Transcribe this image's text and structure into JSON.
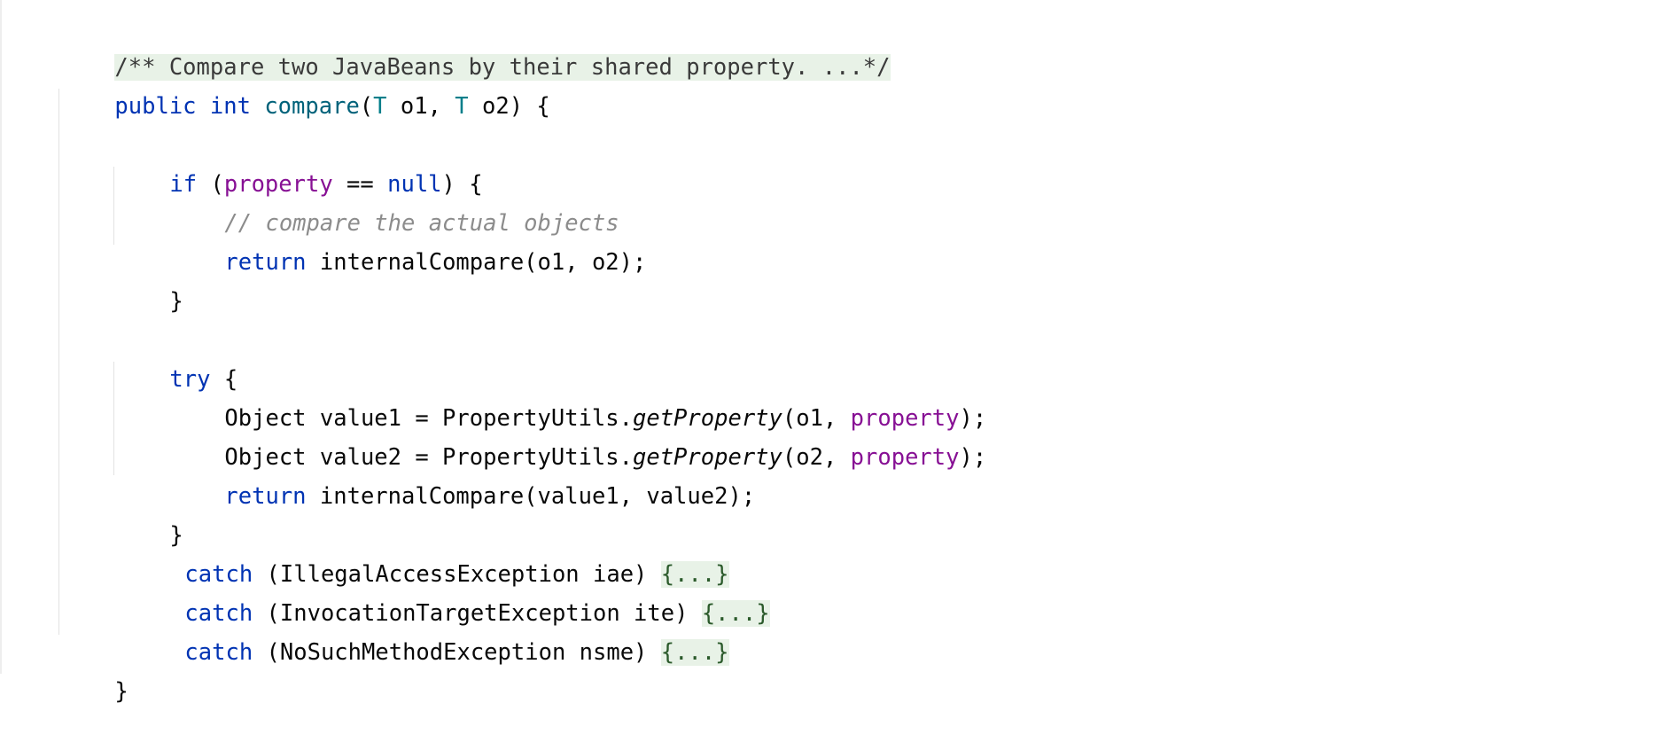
{
  "editor": {
    "doc_fold": "/** Compare two JavaBeans by their shared property. ...*/",
    "sig": {
      "kw_public": "public",
      "kw_int": "int",
      "method": "compare",
      "open_paren": "(",
      "type1": "T",
      "param1": " o1, ",
      "type2": "T",
      "param2": " o2) {"
    },
    "if_line": {
      "kw_if": "if",
      "open": " (",
      "field": "property",
      "op": " == ",
      "kw_null": "null",
      "close": ") {"
    },
    "comment": "// compare the actual objects",
    "return1": {
      "kw": "return",
      "rest": " internalCompare(o1, o2);"
    },
    "close_if": "}",
    "try_line": {
      "kw": "try",
      "rest": " {"
    },
    "value1": {
      "pre": "Object value1 = PropertyUtils.",
      "method": "getProperty",
      "mid": "(o1, ",
      "field": "property",
      "end": ");"
    },
    "value2": {
      "pre": "Object value2 = PropertyUtils.",
      "method": "getProperty",
      "mid": "(o2, ",
      "field": "property",
      "end": ");"
    },
    "return2": {
      "kw": "return",
      "rest": " internalCompare(value1, value2);"
    },
    "close_try": "}",
    "catches": [
      {
        "kw": "catch",
        "rest": " (IllegalAccessException iae) ",
        "fold": "{...}"
      },
      {
        "kw": "catch",
        "rest": " (InvocationTargetException ite) ",
        "fold": "{...}"
      },
      {
        "kw": "catch",
        "rest": " (NoSuchMethodException nsme) ",
        "fold": "{...}"
      }
    ],
    "close_method": "}"
  },
  "colors": {
    "keyword": "#0033b3",
    "method_decl": "#00627a",
    "type_param": "#007e8a",
    "field": "#871094",
    "comment": "#8c8c8c",
    "fold_bg": "#e8f2e7"
  }
}
